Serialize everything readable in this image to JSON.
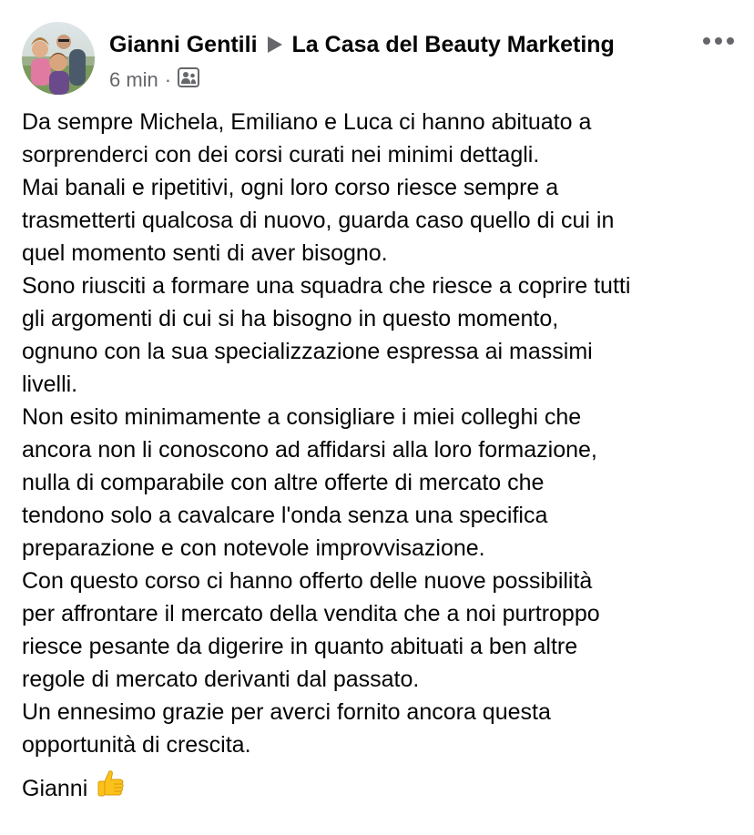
{
  "post": {
    "author": "Gianni Gentili",
    "group": "La Casa del Beauty Marketing",
    "time": "6 min",
    "separator": "·",
    "audience_icon": "group-audience-icon",
    "more_icon": "more-options-icon",
    "body_lines": [
      "Da sempre Michela, Emiliano e Luca ci hanno abituato a",
      "sorprenderci con dei corsi  curati nei minimi dettagli.",
      "Mai banali e ripetitivi, ogni loro corso riesce sempre a",
      "trasmetterti qualcosa di nuovo, guarda caso quello di cui in",
      "quel momento senti di aver bisogno.",
      "Sono riusciti a formare una squadra che riesce a coprire tutti",
      "gli argomenti di cui si ha bisogno in questo momento,",
      "ognuno con la sua specializzazione espressa ai massimi",
      "livelli.",
      "Non esito minimamente a consigliare i miei colleghi che",
      "ancora non li conoscono ad affidarsi alla loro formazione,",
      "nulla di comparabile con altre offerte di mercato che",
      "tendono solo a cavalcare l'onda senza una specifica",
      "preparazione e con notevole improvvisazione.",
      "Con questo corso ci hanno offerto delle nuove possibilità",
      "per affrontare il mercato della vendita che a noi purtroppo",
      "riesce pesante da digerire in quanto abituati a ben altre",
      "regole di mercato derivanti dal passato.",
      "Un ennesimo grazie per averci fornito ancora questa",
      "opportunità di crescita."
    ],
    "signature": "Gianni",
    "signature_emoji": "thumbs-up-icon"
  },
  "colors": {
    "text": "#050505",
    "secondary_text": "#65676b",
    "icon_gray": "#65676b",
    "background": "#ffffff"
  }
}
